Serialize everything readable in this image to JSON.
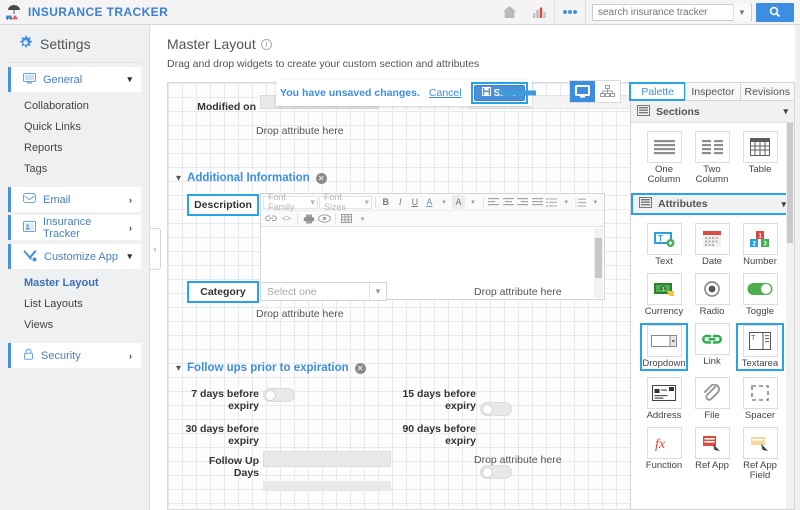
{
  "topbar": {
    "brand": "INSURANCE TRACKER",
    "icons": [
      "home-icon",
      "chart-icon",
      "more-icon"
    ],
    "search_placeholder": "search insurance tracker",
    "search_value": "",
    "search_button": "search-icon"
  },
  "sidebar": {
    "heading": "Settings",
    "groups": [
      {
        "label": "General",
        "icon": "monitor-icon",
        "expanded": true,
        "children": [
          "Collaboration",
          "Quick Links",
          "Reports",
          "Tags"
        ]
      },
      {
        "label": "Email",
        "icon": "envelope-icon",
        "expanded": false,
        "children": []
      },
      {
        "label": "Insurance Tracker",
        "icon": "app-icon",
        "expanded": false,
        "children": []
      },
      {
        "label": "Customize App",
        "icon": "tools-icon",
        "expanded": true,
        "children": [
          "Master Layout",
          "List Layouts",
          "Views"
        ],
        "active_child": "Master Layout"
      },
      {
        "label": "Security",
        "icon": "lock-icon",
        "expanded": false,
        "children": []
      }
    ]
  },
  "page": {
    "title": "Master Layout",
    "subtitle": "Drag and drop widgets to create your custom section and attributes"
  },
  "banner": {
    "message": "You have unsaved changes.",
    "cancel_label": "Cancel",
    "save_label": "Save",
    "save_icon": "floppy-disk-icon",
    "highlighted": true
  },
  "view_toggle": {
    "options": [
      "desktop-icon",
      "hierarchy-icon"
    ],
    "active": "desktop-icon"
  },
  "canvas": {
    "top_partial_label": "Modified on",
    "drops": [
      "Drop attribute here",
      "Drop attribute here",
      "Drop attribute here",
      "Drop attribute here"
    ],
    "sections": [
      {
        "title": "Additional Information",
        "fields": [
          {
            "label": "Description",
            "type": "richtext",
            "highlighted": true
          },
          {
            "label": "Category",
            "type": "select",
            "value": "Select one",
            "highlighted": true
          }
        ]
      },
      {
        "title": "Follow ups prior to expiration",
        "fields": [
          {
            "label": "7 days before expiry",
            "type": "toggle",
            "on": false
          },
          {
            "label": "15 days before expiry",
            "type": "toggle",
            "on": false
          },
          {
            "label": "30 days before expiry",
            "type": "toggle",
            "on": false
          },
          {
            "label": "90 days before expiry",
            "type": "toggle",
            "on": false
          },
          {
            "label": "Follow Up Days",
            "type": "text",
            "value": ""
          }
        ]
      }
    ],
    "editor_toolbar": {
      "font_family": "Font Family",
      "font_sizes": "Font Sizes",
      "buttons": [
        "B",
        "I",
        "U",
        "A",
        "A"
      ],
      "align": [
        "align-left-icon",
        "align-center-icon",
        "align-right-icon",
        "align-justify-icon"
      ],
      "lists": [
        "bullet-list-icon",
        "numbered-list-icon"
      ],
      "row2": [
        "link-icon",
        "code-icon",
        "print-icon",
        "preview-icon",
        "table-icon"
      ]
    }
  },
  "right_panel": {
    "tabs": [
      {
        "label": "Palette",
        "active": true
      },
      {
        "label": "Inspector",
        "active": false
      },
      {
        "label": "Revisions",
        "active": false
      }
    ],
    "sections_group": {
      "title": "Sections",
      "icon": "sections-icon",
      "items": [
        {
          "label": "One Column",
          "icon": "one-column-icon"
        },
        {
          "label": "Two Column",
          "icon": "two-column-icon"
        },
        {
          "label": "Table",
          "icon": "table-icon"
        }
      ]
    },
    "attributes_group": {
      "title": "Attributes",
      "icon": "attributes-icon",
      "highlighted": true,
      "items": [
        {
          "label": "Text",
          "icon": "text-icon",
          "highlighted": false
        },
        {
          "label": "Date",
          "icon": "date-icon",
          "highlighted": false
        },
        {
          "label": "Number",
          "icon": "number-icon",
          "highlighted": false
        },
        {
          "label": "Currency",
          "icon": "currency-icon",
          "highlighted": false
        },
        {
          "label": "Radio",
          "icon": "radio-icon",
          "highlighted": false
        },
        {
          "label": "Toggle",
          "icon": "toggle-icon",
          "highlighted": false
        },
        {
          "label": "Dropdown",
          "icon": "dropdown-icon",
          "highlighted": true
        },
        {
          "label": "Link",
          "icon": "link-icon",
          "highlighted": false
        },
        {
          "label": "Textarea",
          "icon": "textarea-icon",
          "highlighted": true
        },
        {
          "label": "Address",
          "icon": "address-icon",
          "highlighted": false
        },
        {
          "label": "File",
          "icon": "paperclip-icon",
          "highlighted": false
        },
        {
          "label": "Spacer",
          "icon": "spacer-icon",
          "highlighted": false
        },
        {
          "label": "Function",
          "icon": "function-icon",
          "highlighted": false
        },
        {
          "label": "Ref App",
          "icon": "ref-app-icon",
          "highlighted": false
        },
        {
          "label": "Ref App Field",
          "icon": "ref-app-field-icon",
          "highlighted": false
        }
      ]
    }
  },
  "colors": {
    "accent_blue": "#3d8ee0",
    "highlight_blue": "#29a3e8",
    "sidebar_bg": "#eef0f2"
  }
}
